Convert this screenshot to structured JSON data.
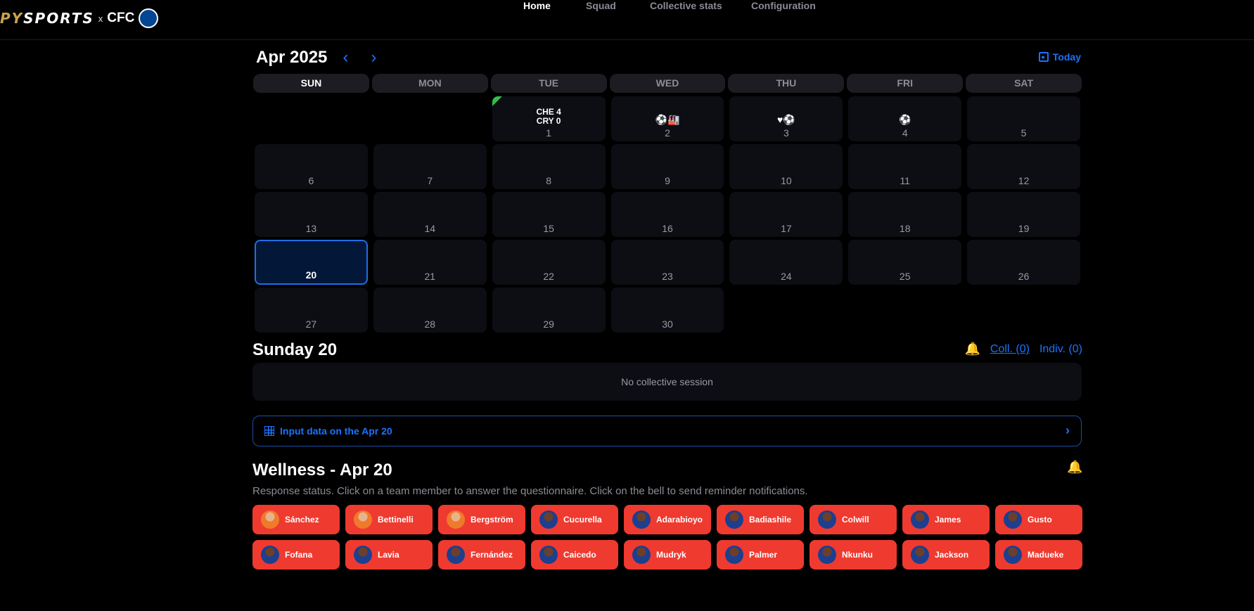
{
  "brand": {
    "py_gold": "PY",
    "py_white": "SPORTS",
    "x": "x",
    "club": "CFC",
    "crest": "CFC"
  },
  "nav": [
    {
      "label": "Home",
      "active": true
    },
    {
      "label": "Squad",
      "active": false
    },
    {
      "label": "Collective stats",
      "active": false
    },
    {
      "label": "Configuration",
      "active": false
    }
  ],
  "calendar": {
    "month_label": "Apr 2025",
    "prev_icon": "‹",
    "next_icon": "›",
    "today_label": "Today",
    "weekdays": [
      "SUN",
      "MON",
      "TUE",
      "WED",
      "THU",
      "FRI",
      "SAT"
    ],
    "days": {
      "1": "1",
      "2": "2",
      "3": "3",
      "4": "4",
      "5": "5",
      "6": "6",
      "7": "7",
      "8": "8",
      "9": "9",
      "10": "10",
      "11": "11",
      "12": "12",
      "13": "13",
      "14": "14",
      "15": "15",
      "16": "16",
      "17": "17",
      "18": "18",
      "19": "19",
      "20": "20",
      "21": "21",
      "22": "22",
      "23": "23",
      "24": "24",
      "25": "25",
      "26": "26",
      "27": "27",
      "28": "28",
      "29": "29",
      "30": "30"
    },
    "events": {
      "d1_line1": "CHE 4",
      "d1_line2": "CRY 0",
      "d2_icons": "⚽🏭",
      "d3_icons": "♥⚽",
      "d4_icons": "⚽"
    },
    "colors": {
      "accent": "#1a73ff",
      "win_flag": "#2fbf4f"
    }
  },
  "day": {
    "title": "Sunday 20",
    "bell_icon": "🔔",
    "coll": "Coll. (0)",
    "indiv": "Indiv. (0)",
    "session_text": "No collective session",
    "input_label": "Input data on the Apr 20",
    "input_chev": "›"
  },
  "wellness": {
    "title": "Wellness - Apr 20",
    "description": "Response status. Click on a team member to answer the questionnaire. Click on the bell to send reminder notifications.",
    "status_color": "#ef3a30",
    "players": [
      "Sánchez",
      "Bettinelli",
      "Bergström",
      "Cucurella",
      "Adarabioyo",
      "Badiashile",
      "Colwill",
      "James",
      "Gusto",
      "Fofana",
      "Lavia",
      "Fernández",
      "Caicedo",
      "Mudryk",
      "Palmer",
      "Nkunku",
      "Jackson",
      "Madueke"
    ]
  }
}
